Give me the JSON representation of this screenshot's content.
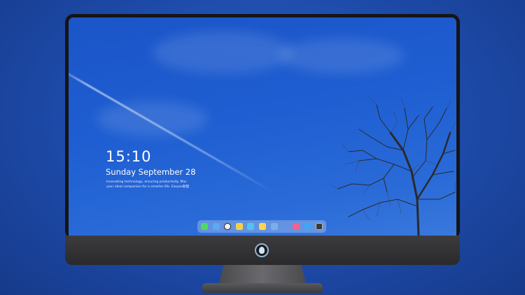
{
  "lock_screen": {
    "time": "15:10",
    "date": "Sunday September 28",
    "tagline_line1": "Innovating technology, ensuring productivity. Mac",
    "tagline_line2": "your ideal companion for a smarter life. Easyos助理"
  },
  "dock": {
    "apps": [
      {
        "name": "messages-icon",
        "color": "#4cd964"
      },
      {
        "name": "finder-icon",
        "color": "#5aa9f5"
      },
      {
        "name": "clock-icon",
        "color": "#f2f2f2"
      },
      {
        "name": "notes-icon",
        "color": "#f0d24a"
      },
      {
        "name": "video-app-icon",
        "color": "#4fc3f7"
      },
      {
        "name": "stickies-icon",
        "color": "#ffd54a"
      },
      {
        "name": "photos-icon",
        "color": "#7ab0e8"
      },
      {
        "name": "music-icon",
        "color": "#f06292"
      },
      {
        "name": "app-store-icon",
        "color": "#42a5f5"
      },
      {
        "name": "terminal-icon",
        "color": "#3a3a3a"
      }
    ]
  },
  "colors": {
    "wallpaper_sky": "#1e5ed2",
    "bezel": "#151515",
    "chin": "#3c3c3f"
  }
}
